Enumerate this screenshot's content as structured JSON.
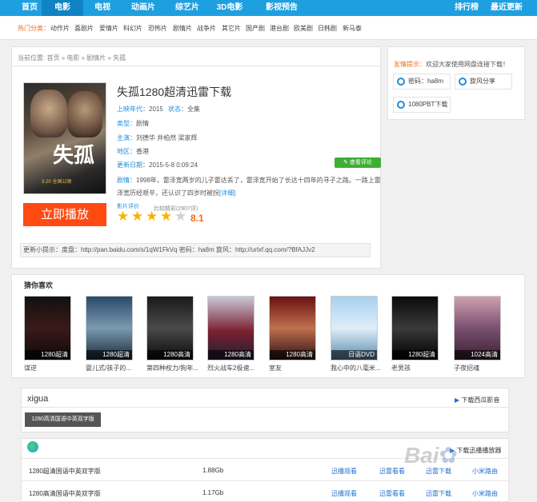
{
  "nav": {
    "items": [
      "首页",
      "电影",
      "电视",
      "动画片",
      "综艺片",
      "3D电影",
      "影视预告"
    ],
    "right": [
      "排行榜",
      "最近更新"
    ]
  },
  "categories": {
    "label": "热门分类：",
    "items": [
      "动作片",
      "喜剧片",
      "爱情片",
      "科幻片",
      "恐怖片",
      "剧情片",
      "战争片",
      "其它片",
      "国产剧",
      "港台剧",
      "欧美剧",
      "日韩剧",
      "新马泰"
    ]
  },
  "breadcrumb": "当前位置: 首页 » 电影 » 剧情片 » 失孤",
  "movie": {
    "title": "失孤1280超清迅雷下载",
    "poster_title": "失孤",
    "poster_date": "3.20 全国公映",
    "year_label": "上映年代：",
    "year": "2015",
    "status_label": "状态：",
    "status": "全集",
    "genre_label": "类型：",
    "genre": "剧情",
    "cast_label": "主演：",
    "cast": "刘德华  井柏然  梁家辉",
    "region_label": "地区：",
    "region": "香港",
    "updated_label": "更新日期：",
    "updated": "2015-5-8 0:09:24",
    "comment_btn": "查看评论",
    "synopsis_label": "剧情：",
    "synopsis": "1998年，雷泽宽两岁的儿子雷达丢了，雷泽宽开始了长达十四年的寻子之路。一路上雷泽宽历经艰辛，还认识了四岁时被拐",
    "detail_link": "[详细]",
    "rating_label": "影片评价",
    "rating_count": "比较精彩(2907评)",
    "rating_stars": 4,
    "rating_total": 5,
    "score": "8.1",
    "play_button": "立即播放",
    "tip": "更新小提示：度盘：http://pan.baidu.com/s/1qW1FkVq 密码：ha8m 旋风：http://urlxf.qq.com/?BfAJJv2"
  },
  "notice": {
    "label": "友情提示：",
    "text": "欢迎大家使用网盘连接下载！",
    "shares": [
      "密码：ha8m",
      "旋风分享",
      "1080PBT下载"
    ]
  },
  "recommendations": {
    "title": "猜你喜欢",
    "items": [
      {
        "caption": "谋逆",
        "badge": "1280超清"
      },
      {
        "caption": "婴儿式/孩子的...",
        "badge": "1280超清"
      },
      {
        "caption": "第四种权力/狗年...",
        "badge": "1280高清"
      },
      {
        "caption": "烈火战车2极速...",
        "badge": "1280高清"
      },
      {
        "caption": "室友",
        "badge": "1280高清"
      },
      {
        "caption": "我心中的八毫米...",
        "badge": "日语DVD"
      },
      {
        "caption": "老男孩",
        "badge": "1280超清"
      },
      {
        "caption": "子夜招魂",
        "badge": "1024高清"
      }
    ]
  },
  "download": {
    "section_title": "xigua",
    "section_link": "下载西瓜影音",
    "tag": "1280高清国语中英双字版",
    "player_link": "下载迅播播放器",
    "rows": [
      {
        "name": "1280超清国语中英双字版",
        "size": "1.88Gb",
        "actions": [
          "迅播观看",
          "迅雷看看",
          "迅雷下载",
          "小米路由"
        ]
      },
      {
        "name": "1280高清国语中英双字版",
        "size": "1.17Gb",
        "actions": [
          "迅播观看",
          "迅雷看看",
          "迅雷下载",
          "小米路由"
        ]
      }
    ]
  },
  "colors": {
    "nav_bg": "#1e9fe0",
    "accent": "#1e8ed8",
    "play": "#ff4a12",
    "star": "#f5b400"
  }
}
